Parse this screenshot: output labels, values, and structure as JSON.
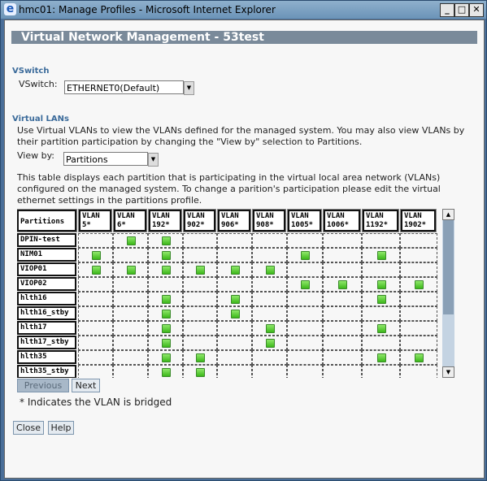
{
  "window": {
    "title": "hmc01: Manage Profiles - Microsoft Internet Explorer"
  },
  "page": {
    "header": "Virtual Network Management - 53test"
  },
  "vswitch": {
    "section": "VSwitch",
    "label": "VSwitch:",
    "value": "ETHERNET0(Default)"
  },
  "vlans": {
    "section": "Virtual LANs",
    "desc": "Use Virtual VLANs to view the VLANs defined for the managed system. You may also view VLANs by their partition participation by changing the \"View by\" selection to Partitions.",
    "viewby_label": "View by:",
    "viewby_value": "Partitions",
    "table_desc": "This table displays each partition that is participating in the virtual local area network (VLANs) configured on the managed system. To change a parition's participation please edit the virtual ethernet settings in the partitions profile."
  },
  "table": {
    "corner": "Partitions",
    "columns": [
      "VLAN 5*",
      "VLAN 6*",
      "VLAN 192*",
      "VLAN 902*",
      "VLAN 906*",
      "VLAN 908*",
      "VLAN 1005*",
      "VLAN 1006*",
      "VLAN 1192*",
      "VLAN 1902*"
    ],
    "rows": [
      {
        "name": "DPIN-test",
        "member": [
          0,
          1,
          1,
          0,
          0,
          0,
          0,
          0,
          0,
          0
        ]
      },
      {
        "name": "NIM01",
        "member": [
          1,
          0,
          1,
          0,
          0,
          0,
          1,
          0,
          1,
          0
        ]
      },
      {
        "name": "VIOP01",
        "member": [
          1,
          1,
          1,
          1,
          1,
          1,
          0,
          0,
          0,
          0
        ]
      },
      {
        "name": "VIOP02",
        "member": [
          0,
          0,
          0,
          0,
          0,
          0,
          1,
          1,
          1,
          1
        ]
      },
      {
        "name": "hlth16",
        "member": [
          0,
          0,
          1,
          0,
          1,
          0,
          0,
          0,
          1,
          0
        ]
      },
      {
        "name": "hlth16_stby",
        "member": [
          0,
          0,
          1,
          0,
          1,
          0,
          0,
          0,
          0,
          0
        ]
      },
      {
        "name": "hlth17",
        "member": [
          0,
          0,
          1,
          0,
          0,
          1,
          0,
          0,
          1,
          0
        ]
      },
      {
        "name": "hlth17_stby",
        "member": [
          0,
          0,
          1,
          0,
          0,
          1,
          0,
          0,
          0,
          0
        ]
      },
      {
        "name": "hlth35",
        "member": [
          0,
          0,
          1,
          1,
          0,
          0,
          0,
          0,
          1,
          1
        ]
      },
      {
        "name": "hlth35_stby",
        "member": [
          0,
          0,
          1,
          1,
          0,
          0,
          0,
          0,
          0,
          0
        ]
      }
    ]
  },
  "paging": {
    "previous": "Previous",
    "next": "Next"
  },
  "note": "* Indicates the VLAN is bridged",
  "buttons": {
    "close": "Close",
    "help": "Help"
  },
  "colors": {
    "member": "#3cb81a",
    "header_band": "#7a8a9a",
    "section": "#3a6a9a"
  }
}
